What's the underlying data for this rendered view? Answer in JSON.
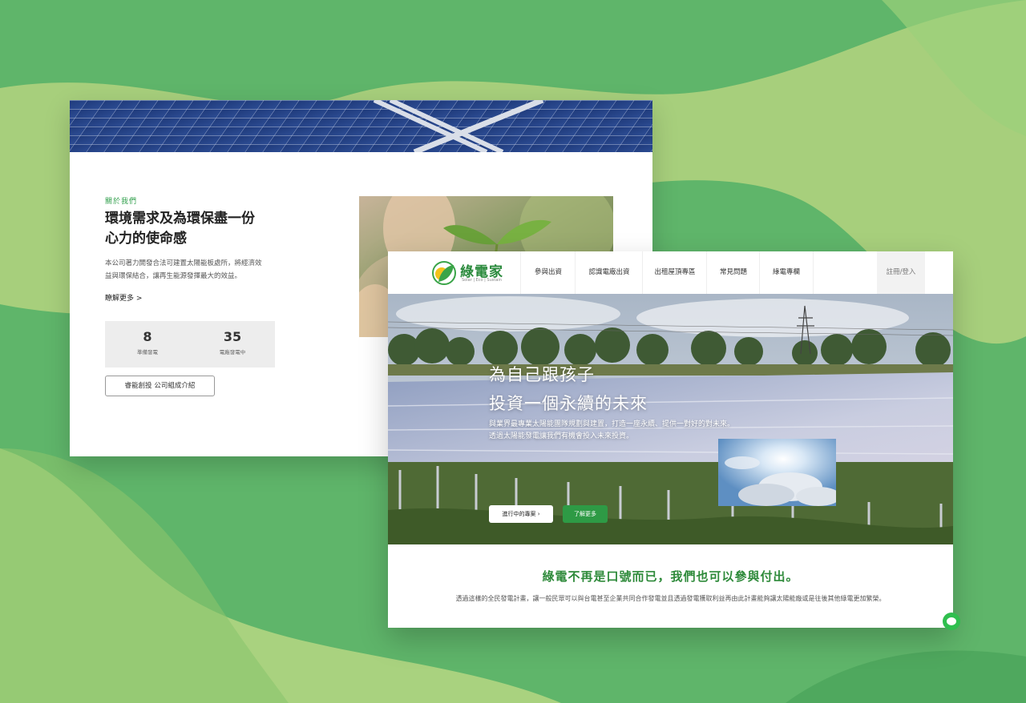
{
  "colors": {
    "bg_green": "#5fb56a",
    "bg_light_green": "#a8cf7e",
    "accent_green": "#2e9a45",
    "title_green": "#2e8a3a"
  },
  "about": {
    "label": "關於我們",
    "title_line1": "環境需求及為環保盡一份",
    "title_line2": "心力的使命感",
    "desc_line1": "本公司著力開發合法可建置太陽能板處所，將經濟效",
    "desc_line2": "益與環保結合，讓再生能源發揮最大的效益。",
    "more_link": "瞭解更多 >",
    "stats": [
      {
        "number": "8",
        "label": "準備發電"
      },
      {
        "number": "35",
        "label": "電廠發電中"
      }
    ],
    "intro_button": "睿能創投 公司組成介紹"
  },
  "site": {
    "logo_text": "綠電家",
    "logo_sub": "Solar | Eco | Sustain",
    "nav": [
      "參與出資",
      "認識電廠出資",
      "出租屋頂專區",
      "常見問題",
      "綠電專欄"
    ],
    "login": "註冊/登入"
  },
  "hero": {
    "title_line1": "為自己跟孩子",
    "title_line2": "投資一個永續的未來",
    "desc_line1": "與業界最專業太陽能團隊規劃與建置，打造一座永續、提供一對好的對未來。",
    "desc_line2": "透過太陽能發電讓我們有機會投入未來投資。",
    "btn_projects": "進行中的專案 ›",
    "btn_more": "了解更多"
  },
  "slogan": {
    "title": "綠電不再是口號而已，我們也可以參與付出。",
    "desc": "透過這樣的全民發電計畫，讓一般民眾可以與台電甚至企業共同合作發電並且透過發電獲取利益再由此計畫能夠讓太陽能廠或是往後其他綠電更加繁榮。"
  },
  "icons": {
    "logo": "leaf-sun-logo-icon",
    "chat": "chat-bubble-icon"
  }
}
